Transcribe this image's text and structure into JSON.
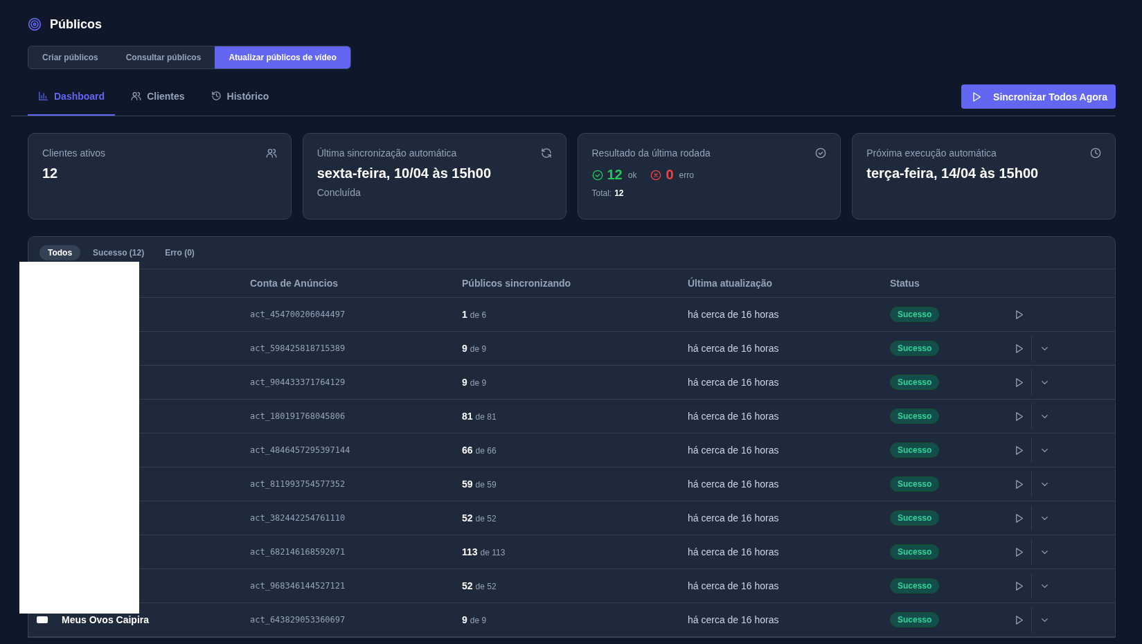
{
  "header": {
    "title": "Públicos"
  },
  "section_tabs": [
    {
      "label": "Criar públicos",
      "selected": false
    },
    {
      "label": "Consultar públicos",
      "selected": false
    },
    {
      "label": "Atualizar públicos de vídeo",
      "selected": true
    }
  ],
  "nav_tabs": [
    {
      "label": "Dashboard",
      "selected": true
    },
    {
      "label": "Clientes",
      "selected": false
    },
    {
      "label": "Histórico",
      "selected": false
    }
  ],
  "sync_button": "Sincronizar Todos Agora",
  "cards": [
    {
      "kind": "value",
      "title": "Clientes ativos",
      "value": "12"
    },
    {
      "kind": "value",
      "title": "Última sincronização automática",
      "value": "sexta-feira, 10/04 às 15h00",
      "note": "Concluída"
    },
    {
      "kind": "result",
      "title": "Resultado da última rodada",
      "ok": "12",
      "ok_label": "ok",
      "error": "0",
      "error_label": "erro",
      "total_label": "Total:",
      "total": "12"
    },
    {
      "kind": "value",
      "title": "Próxima execução automática",
      "value": "terça-feira, 14/04 às 15h00"
    }
  ],
  "filters": [
    {
      "label": "Todos",
      "selected": true
    },
    {
      "label": "Sucesso",
      "count": "(12)",
      "selected": false
    },
    {
      "label": "Erro",
      "count": "(0)",
      "selected": false
    }
  ],
  "table": {
    "columns": [
      "Conta de Anúncios",
      "Públicos sincronizando",
      "Última atualização",
      "Status"
    ],
    "rows": [
      {
        "account": "act_454700206044497",
        "synced": "1",
        "total": "de 6",
        "updated": "há cerca de 16 horas",
        "status": "Sucesso",
        "expandable": false
      },
      {
        "account": "act_598425818715389",
        "synced": "9",
        "total": "de 9",
        "updated": "há cerca de 16 horas",
        "status": "Sucesso",
        "expandable": true
      },
      {
        "account": "act_904433371764129",
        "synced": "9",
        "total": "de 9",
        "updated": "há cerca de 16 horas",
        "status": "Sucesso",
        "expandable": true
      },
      {
        "account": "act_180191768045806",
        "synced": "81",
        "total": "de 81",
        "updated": "há cerca de 16 horas",
        "status": "Sucesso",
        "expandable": true
      },
      {
        "account": "act_4846457295397144",
        "synced": "66",
        "total": "de 66",
        "updated": "há cerca de 16 horas",
        "status": "Sucesso",
        "expandable": true
      },
      {
        "account": "act_811993754577352",
        "synced": "59",
        "total": "de 59",
        "updated": "há cerca de 16 horas",
        "status": "Sucesso",
        "expandable": true
      },
      {
        "account": "act_382442254761110",
        "synced": "52",
        "total": "de 52",
        "updated": "há cerca de 16 horas",
        "status": "Sucesso",
        "expandable": true
      },
      {
        "account": "act_682146168592071",
        "synced": "113",
        "total": "de 113",
        "updated": "há cerca de 16 horas",
        "status": "Sucesso",
        "expandable": true
      },
      {
        "account": "act_968346144527121",
        "synced": "52",
        "total": "de 52",
        "updated": "há cerca de 16 horas",
        "status": "Sucesso",
        "expandable": true
      },
      {
        "name": "Meus Ovos Caipira",
        "account": "act_643829053360697",
        "synced": "9",
        "total": "de 9",
        "updated": "há cerca de 16 horas",
        "status": "Sucesso",
        "expandable": true
      }
    ]
  }
}
